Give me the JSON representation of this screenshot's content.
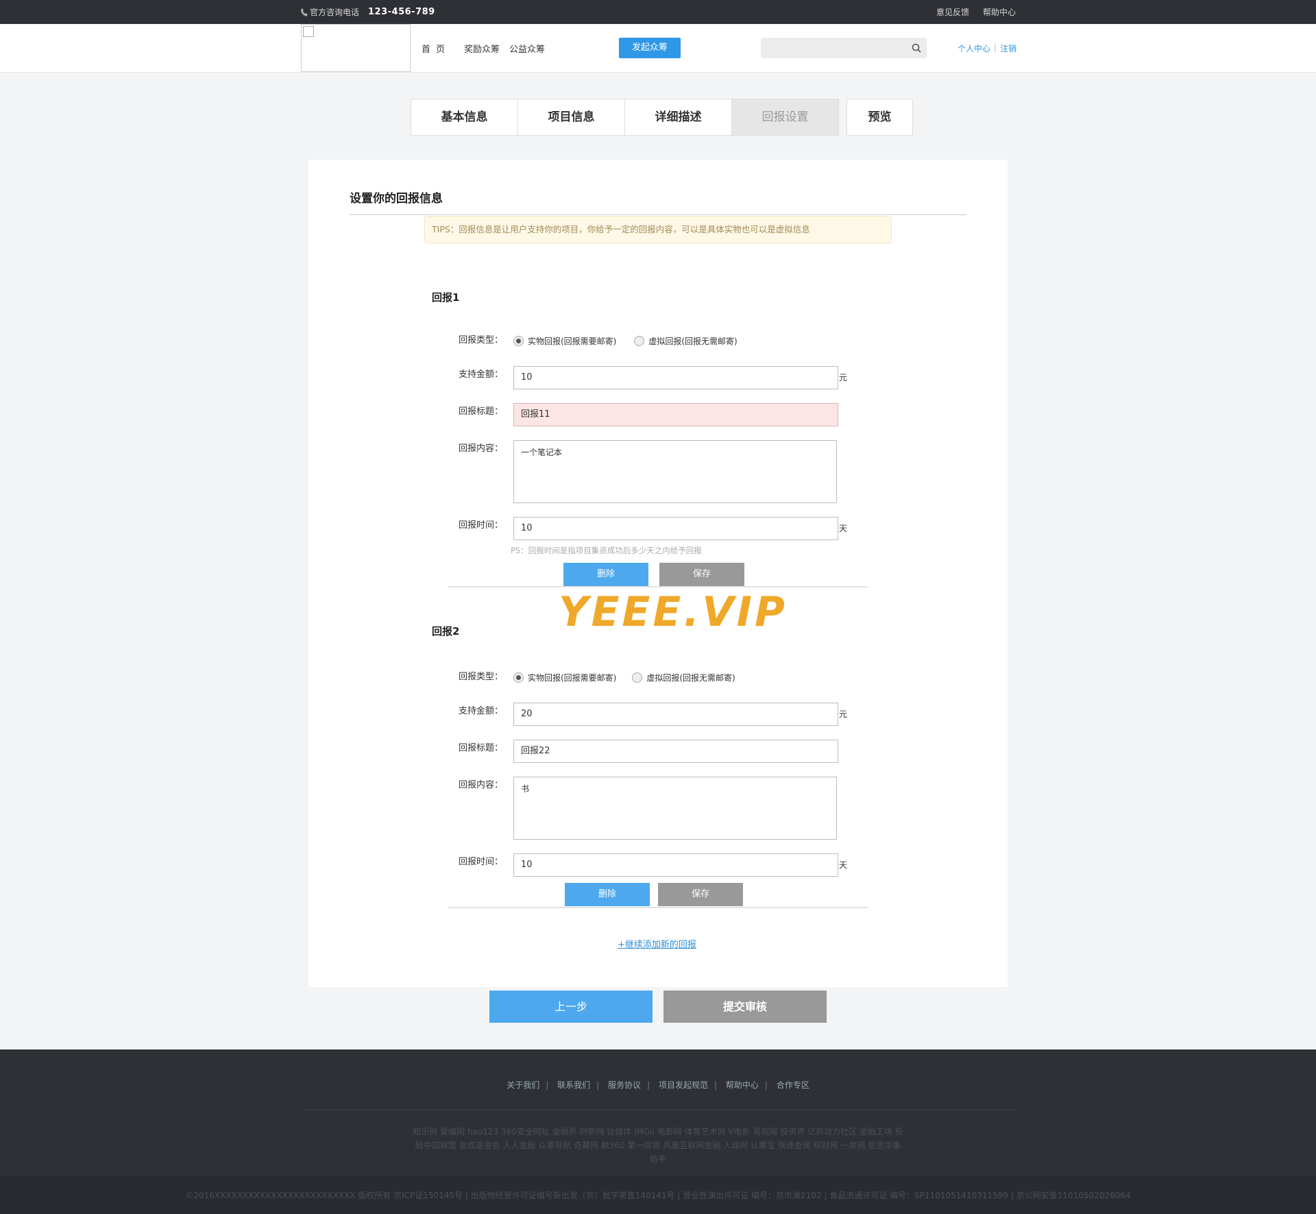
{
  "topbar": {
    "phone_label": "官方咨询电话",
    "phone_number": "123-456-789",
    "links": [
      "意见反馈",
      "帮助中心"
    ]
  },
  "header": {
    "nav": [
      "首页",
      "奖励众筹",
      "公益众筹"
    ],
    "launch_button": "发起众筹",
    "search_placeholder": "",
    "user_center": "个人中心",
    "logout": "注销"
  },
  "steps": {
    "items": [
      "基本信息",
      "项目信息",
      "详细描述",
      "回报设置"
    ],
    "active": "回报设置",
    "preview": "预览"
  },
  "card": {
    "title": "设置你的回报信息",
    "tips": "TIPS：回报信息是让用户支持你的项目，你给予一定的回报内容，可以是具体实物也可以是虚拟信息"
  },
  "labels": {
    "type": "回报类型：",
    "amount": "支持金额：",
    "title": "回报标题：",
    "content": "回报内容：",
    "time": "回报时间：",
    "physical": "实物回报(回报需要邮寄)",
    "virtual": "虚拟回报(回报无需邮寄)",
    "unit_yuan": "元",
    "unit_day": "天",
    "ps": "PS：回报时间是指项目集资成功后多少天之内给予回报",
    "delete": "删除",
    "save": "保存"
  },
  "rewards": [
    {
      "heading": "回报1",
      "type": "physical",
      "amount": "10",
      "title": "回报11",
      "title_error": true,
      "content": "一个笔记本",
      "time": "10"
    },
    {
      "heading": "回报2",
      "type": "physical",
      "amount": "20",
      "title": "回报22",
      "title_error": false,
      "content": "书",
      "time": "10"
    }
  ],
  "watermark": "YEEE.VIP",
  "add_more": "+继续添加新的回报",
  "actions": {
    "prev": "上一步",
    "submit": "提交审核"
  },
  "footer": {
    "links": [
      "关于我们",
      "联系我们",
      "服务协议",
      "项目发起规范",
      "帮助中心",
      "合作专区"
    ],
    "partners": "知乐网 爱编网 hao123 360安全网址 金融界 财新网 钛媒体 IMGii 电影网 体育艺术网 V电影 易观网 投资界 亿邦动力社区 金融工场 投融中国联盟 友成基金会 人人金融 众筹导航 奇幕网 触360 第一房贷 凤凰互联网金融 人球网 认筹宝 快速查阅 帮财网 一房网 佐思华集助手",
    "copyright": "©2016XXXXXXXXXXXXXXXXXXXXXXXXX 版权所有 京ICP证150145号 | 出版物经营许可证编号新出发（京）批字第直140141号 | 营业性演出许可证 编号：京市演2102 | 食品流通许可证 编号：SP1101051410311599 | 京公网安备11010502026064"
  }
}
